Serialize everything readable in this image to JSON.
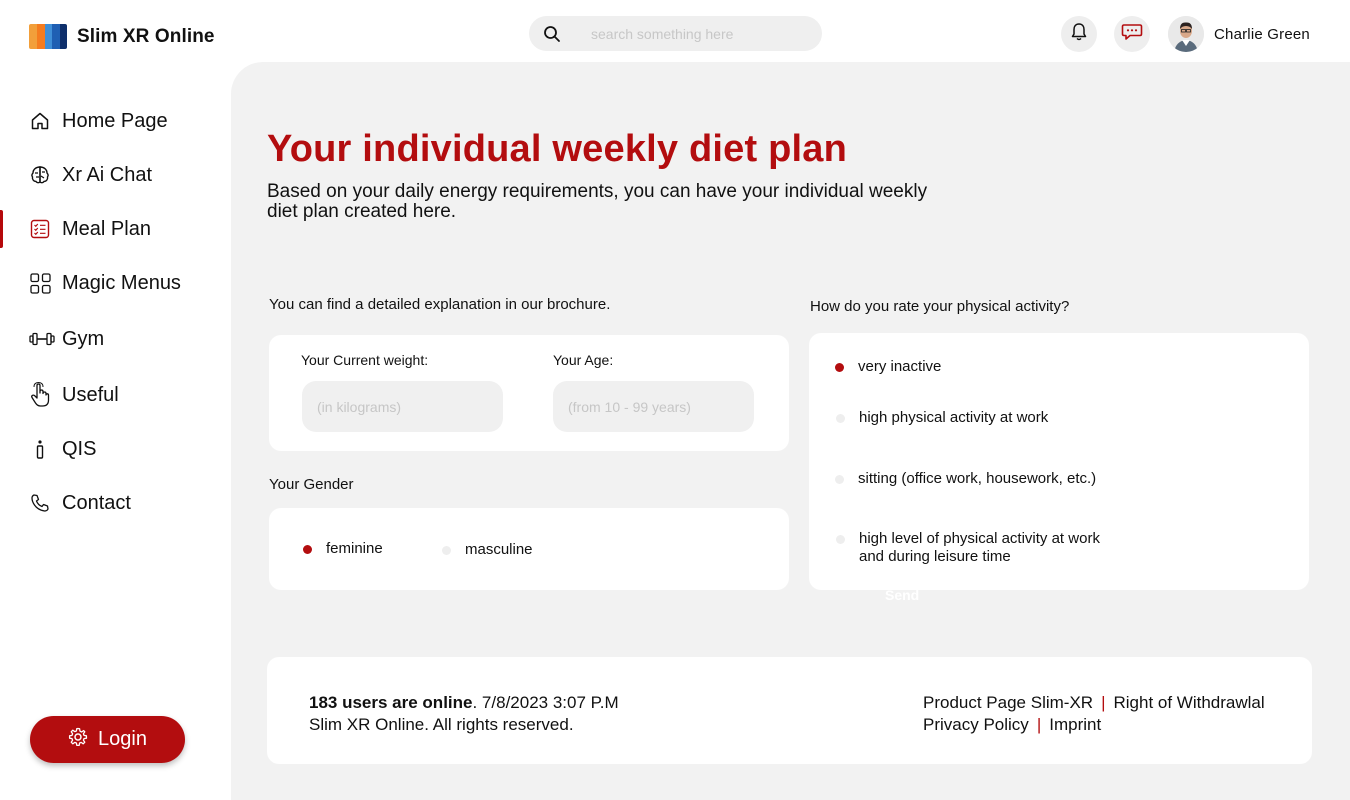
{
  "header": {
    "brand": "Slim XR Online",
    "search_placeholder": "search something here",
    "user_name": "Charlie Green"
  },
  "sidebar": {
    "items": [
      {
        "label": "Home Page",
        "icon": "home-icon"
      },
      {
        "label": "Xr Ai Chat",
        "icon": "brain-icon"
      },
      {
        "label": "Meal Plan",
        "icon": "checklist-icon",
        "active": true
      },
      {
        "label": "Magic Menus",
        "icon": "grid-icon"
      },
      {
        "label": "Gym",
        "icon": "dumbbell-icon"
      },
      {
        "label": "Useful",
        "icon": "hand-pointer-icon"
      },
      {
        "label": "QIS",
        "icon": "info-icon"
      },
      {
        "label": "Contact",
        "icon": "phone-icon"
      }
    ],
    "login_label": "Login"
  },
  "main": {
    "title": "Your individual weekly diet plan",
    "subtitle": "Based on your daily energy requirements, you can have your individual weekly diet plan created here.",
    "brochure_note": "You can find a detailed explanation in our brochure.",
    "weight_label": "Your Current weight:",
    "weight_placeholder": "(in kilograms)",
    "age_label": "Your Age:",
    "age_placeholder": "(from 10 - 99 years)",
    "gender_label": "Your Gender",
    "gender_options": [
      {
        "label": "feminine",
        "selected": true
      },
      {
        "label": "masculine",
        "selected": false
      }
    ],
    "activity_question": "How do you rate your physical activity?",
    "activity_options": [
      {
        "label": "very inactive",
        "selected": true
      },
      {
        "label": "high physical activity at work",
        "selected": false
      },
      {
        "label": "sitting (office work, housework, etc.)",
        "selected": false
      },
      {
        "label": "high level of physical activity at work and during leisure time",
        "selected": false
      }
    ],
    "send_label": "Send"
  },
  "footer": {
    "online_text": "183 users are online",
    "datetime": ". 7/8/2023 3:07 P.M",
    "rights": "Slim XR Online. All rights reserved.",
    "links": [
      "Product Page Slim-XR",
      "Right of Withdrawlal",
      "Privacy Policy",
      "Imprint"
    ]
  },
  "colors": {
    "accent": "#b30d0f",
    "panel": "#f2f2f2",
    "card": "#ffffff"
  }
}
